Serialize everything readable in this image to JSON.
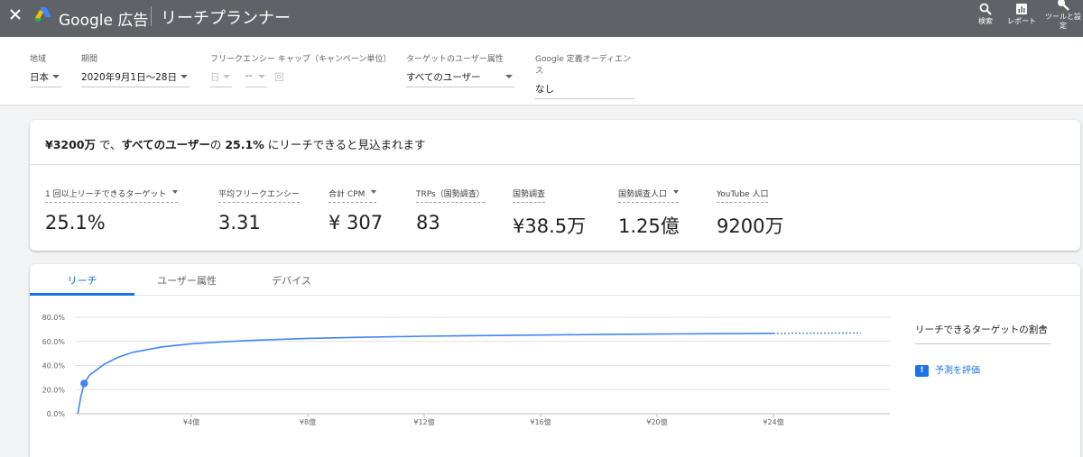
{
  "header": {
    "brand": "Google 広告",
    "tool_title": "リーチプランナー",
    "actions": [
      {
        "label": "検索",
        "icon": "search-icon"
      },
      {
        "label": "レポート",
        "icon": "report-icon"
      },
      {
        "label": "ツールと設定",
        "icon": "wrench-icon"
      }
    ]
  },
  "filters": {
    "region": {
      "label": "地域",
      "value": "日本"
    },
    "period": {
      "label": "期間",
      "value": "2020年9月1日～28日"
    },
    "frequency_cap": {
      "label": "フリークエンシー キャップ（キャンペーン単位）",
      "count": "日",
      "dash": "--",
      "unit": "回"
    },
    "target": {
      "label": "ターゲットのユーザー属性",
      "value": "すべてのユーザー"
    },
    "audience": {
      "label": "Google 定義オーディエンス",
      "value": "なし"
    }
  },
  "summary": {
    "budget": "¥3200万",
    "t1": " で、",
    "audience": "すべてのユーザー",
    "t2": "の ",
    "reach_pct": "25.1%",
    "t3": " にリーチできると見込まれます"
  },
  "metrics": [
    {
      "label": "1 回以上リーチできるターゲット",
      "value": "25.1%",
      "dropdown": true
    },
    {
      "label": "平均フリークエンシー",
      "value": "3.31",
      "dropdown": false
    },
    {
      "label": "合計 CPM",
      "value": "¥ 307",
      "dropdown": true
    },
    {
      "label": "TRPs（国勢調査）",
      "value": "83",
      "dropdown": false
    },
    {
      "label": "国勢調査",
      "value": "¥38.5万",
      "dropdown": false
    },
    {
      "label": "国勢調査人口",
      "value": "1.25億",
      "dropdown": true
    },
    {
      "label": "YouTube 人口",
      "value": "9200万",
      "dropdown": false
    }
  ],
  "tabs": [
    "リーチ",
    "ユーザー属性",
    "デバイス"
  ],
  "side": {
    "metric_select": "リーチできるターゲットの割合",
    "evaluate_label": "予測を評価",
    "evaluate_icon": "feedback-icon"
  },
  "chart_data": {
    "type": "line",
    "y_ticks": [
      "80.0%",
      "60.0%",
      "40.0%",
      "20.0%",
      "0.0%"
    ],
    "x_ticks": [
      "¥4億",
      "¥8億",
      "¥12億",
      "¥16億",
      "¥20億",
      "¥24億"
    ],
    "ylim": [
      0,
      80
    ],
    "xlim": [
      0,
      28
    ],
    "x_unit": "億円",
    "series": [
      {
        "points": [
          [
            0.1,
            0
          ],
          [
            0.2,
            14
          ],
          [
            0.32,
            25.1
          ],
          [
            0.5,
            32
          ],
          [
            1,
            41
          ],
          [
            1.5,
            47
          ],
          [
            2,
            51
          ],
          [
            3,
            55.5
          ],
          [
            4,
            58
          ],
          [
            5,
            59.5
          ],
          [
            6,
            60.8
          ],
          [
            8,
            62.5
          ],
          [
            10,
            63.5
          ],
          [
            12,
            64.3
          ],
          [
            14,
            64.8
          ],
          [
            16,
            65.3
          ],
          [
            18,
            65.7
          ],
          [
            20,
            66.1
          ],
          [
            22,
            66.4
          ],
          [
            24,
            66.7
          ]
        ],
        "projection": [
          [
            24,
            66.7
          ],
          [
            27,
            67.0
          ]
        ],
        "marker": [
          0.32,
          25.1
        ]
      }
    ],
    "colors": {
      "line": "#4285f4",
      "grid": "#e0e0e0"
    }
  }
}
